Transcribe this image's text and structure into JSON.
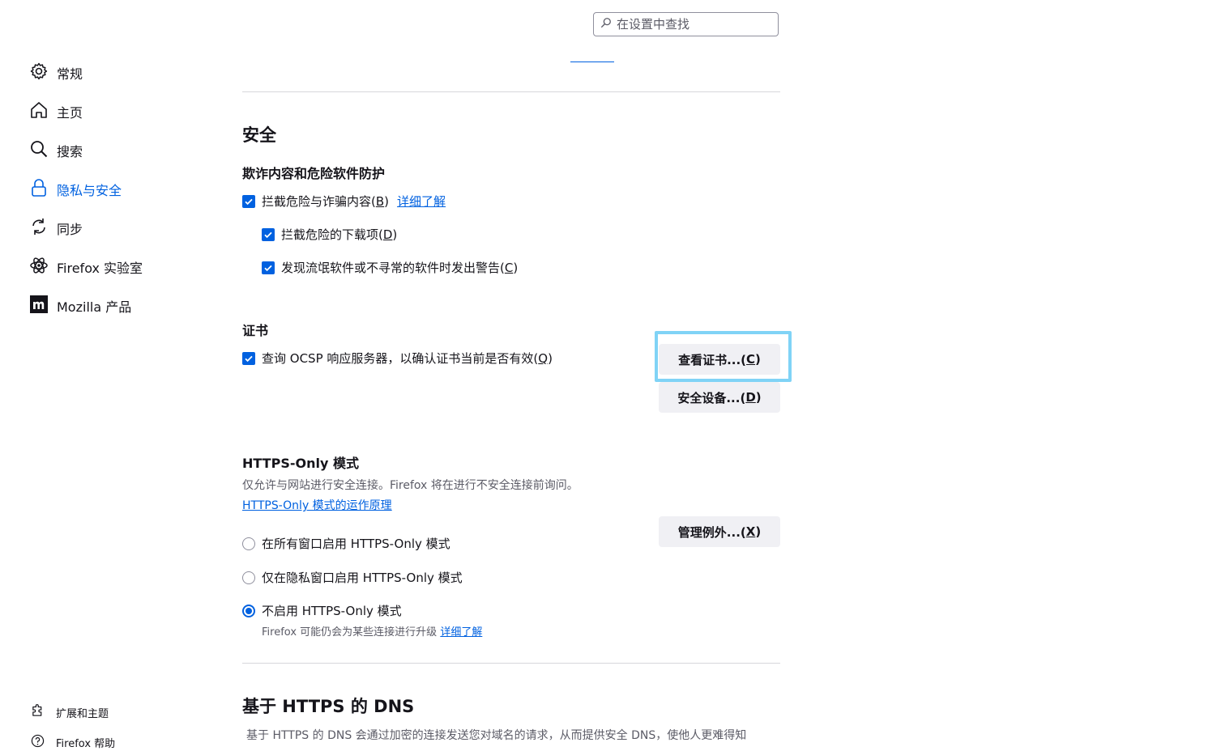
{
  "search": {
    "placeholder": "在设置中查找"
  },
  "sidebar": {
    "items": [
      {
        "label": "常规",
        "icon": "gear-icon"
      },
      {
        "label": "主页",
        "icon": "home-icon"
      },
      {
        "label": "搜索",
        "icon": "search-icon"
      },
      {
        "label": "隐私与安全",
        "icon": "lock-icon",
        "active": true
      },
      {
        "label": "同步",
        "icon": "sync-icon"
      },
      {
        "label": "Firefox 实验室",
        "icon": "labs-atom-icon"
      },
      {
        "label": "Mozilla 产品",
        "icon": "mozilla-logo-icon"
      }
    ],
    "footer": [
      {
        "label": "扩展和主题",
        "icon": "puzzle-icon"
      },
      {
        "label": "Firefox 帮助",
        "icon": "help-icon"
      }
    ]
  },
  "security": {
    "title": "安全",
    "deceptive": {
      "title": "欺诈内容和危险软件防护",
      "block_dangerous": {
        "label": "拦截危险与诈骗内容(",
        "key": "B",
        "suffix": ")",
        "checked": true
      },
      "learn_more": "详细了解",
      "block_downloads": {
        "label": "拦截危险的下载项(",
        "key": "D",
        "suffix": ")",
        "checked": true
      },
      "warn_unwanted": {
        "label": "发现流氓软件或不寻常的软件时发出警告(",
        "key": "C",
        "suffix": ")",
        "checked": true
      }
    },
    "certificates": {
      "title": "证书",
      "ocsp": {
        "label": "查询 OCSP 响应服务器，以确认证书当前是否有效(",
        "key": "Q",
        "suffix": ")",
        "checked": true
      },
      "view_button": {
        "label": "查看证书...(",
        "key": "C",
        "suffix": ")"
      },
      "devices_button": {
        "label": "安全设备...(",
        "key": "D",
        "suffix": ")"
      }
    }
  },
  "https_only": {
    "title": "HTTPS-Only 模式",
    "description": "仅允许与网站进行安全连接。Firefox 将在进行不安全连接前询问。",
    "how_link": "HTTPS-Only 模式的运作原理",
    "exceptions_button": {
      "label": "管理例外...(",
      "key": "X",
      "suffix": ")"
    },
    "options": [
      {
        "label": "在所有窗口启用 HTTPS-Only 模式",
        "selected": false
      },
      {
        "label": "仅在隐私窗口启用 HTTPS-Only 模式",
        "selected": false
      },
      {
        "label": "不启用 HTTPS-Only 模式",
        "selected": true
      }
    ],
    "note": "Firefox 可能仍会为某些连接进行升级",
    "note_link": "详细了解"
  },
  "dns": {
    "title": "基于 HTTPS 的 DNS",
    "description": "基于 HTTPS 的 DNS 会通过加密的连接发送您对域名的请求，从而提供安全 DNS，使他人更难得知"
  },
  "colors": {
    "accent": "#0061e0",
    "focus_ring": "#80d3f6",
    "button_bg": "#f0f0f4"
  }
}
